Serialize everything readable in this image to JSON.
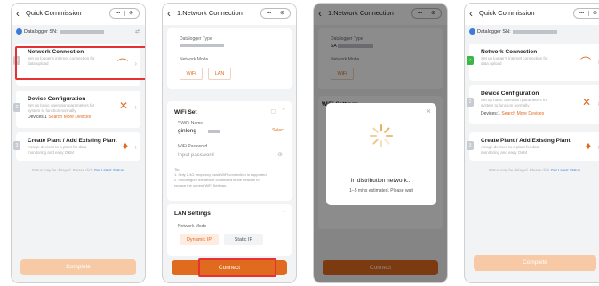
{
  "panels": [
    {
      "title": "Quick Commission",
      "pill": {
        "a": "•••",
        "b": "⊗"
      },
      "datalogger_label": "Datalogger SN:",
      "cards": [
        {
          "step": "1",
          "title": "Network Connection",
          "desc": "Set up logger's internet connection for data upload",
          "link": ""
        },
        {
          "step": "2",
          "title": "Device Configuration",
          "desc": "Set up basic operation parameters for system to function normally",
          "link_prefix": "Devices:1",
          "link": "Search More Devices"
        },
        {
          "step": "3",
          "title": "Create Plant / Add Existing Plant",
          "desc": "Assign devices to a plant for data monitoring and easy O&M",
          "link": ""
        }
      ],
      "status_text": "Status may be delayed. Please click",
      "status_link": "Get Latest Status.",
      "button": "Complete"
    },
    {
      "title": "1.Network Connection",
      "pill": {
        "a": "•••",
        "b": "⊗"
      },
      "datalogger_type_label": "Datalogger Type",
      "network_mode_label": "Network Mode",
      "mode_wifi": "WiFi",
      "mode_lan": "LAN",
      "wifi_set": "WiFi Set",
      "wifi_name_label": "* WiFi Name",
      "wifi_name_value": "ginlong-",
      "select_label": "Select",
      "wifi_password_label": "WiFi Password",
      "wifi_password_placeholder": "Input password",
      "tip_lines": [
        "Tip:",
        "1. Only 2.4G frequency band WiFi connection is supported",
        "2. Reconfigure the device connected to the network to",
        "replace the current WiFi Settings."
      ],
      "lan_settings": "LAN Settings",
      "lan_network_mode_label": "Network Mode",
      "dynamic_ip": "Dynamic IP",
      "static_ip": "Static IP",
      "button": "Connect"
    },
    {
      "title": "1.Network Connection",
      "pill": {
        "a": "•••",
        "b": "⊗"
      },
      "datalogger_type_label": "Datalogger Type",
      "datalogger_type_value": "SA",
      "network_mode_label": "Network Mode",
      "mode_wifi": "WiFi",
      "wifi_settings": "WiFi Settings",
      "modal_title": "In distribution network...",
      "modal_sub": "1–3 mins estimated. Please wait",
      "button": "Connect"
    },
    {
      "title": "Quick Commission",
      "pill": {
        "a": "•••",
        "b": "⊗"
      },
      "datalogger_label": "Datalogger SN:",
      "cards": [
        {
          "step": "✓",
          "title": "Network Connection",
          "desc": "Set up logger's internet connection for data upload"
        },
        {
          "step": "2",
          "title": "Device Configuration",
          "desc": "Set up basic operation parameters for system to function normally",
          "link_prefix": "Devices:1",
          "link": "Search More Devices"
        },
        {
          "step": "3",
          "title": "Create Plant / Add Existing Plant",
          "desc": "Assign devices to a plant for data monitoring and easy O&M"
        }
      ],
      "status_text": "Status may be delayed. Please click",
      "status_link": "Get Latest Status.",
      "button": "Complete"
    }
  ],
  "colors": {
    "accent": "#e06a1e",
    "highlight": "#e63232",
    "link": "#3d7bdb",
    "done": "#3cb54a"
  }
}
